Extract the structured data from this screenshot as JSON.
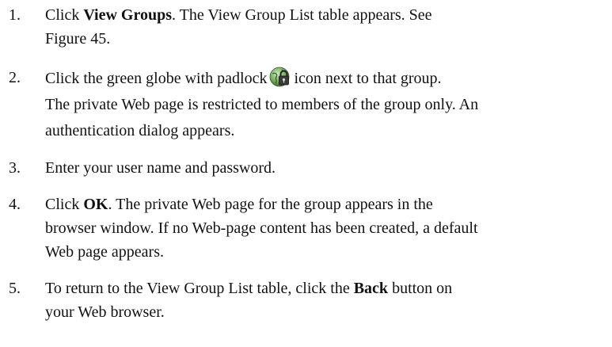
{
  "steps": [
    {
      "number": "1.",
      "line1": {
        "pre": "Click ",
        "bold": "View Groups",
        "post": ". The View Group List table appears. See"
      },
      "line2": "Figure 45."
    },
    {
      "number": "2.",
      "line1": {
        "pre": "Click the green globe with padlock",
        "icon": "globe-padlock-icon",
        "post": "icon next to that group."
      },
      "line2": "The private Web page is restricted to members of the group only. An",
      "line3": "authentication dialog appears."
    },
    {
      "number": "3.",
      "line1": "Enter your user name and password."
    },
    {
      "number": "4.",
      "line1": {
        "pre": "Click ",
        "bold": "OK",
        "post": ". The private Web page for the group appears in the"
      },
      "line2": "browser window. If no Web-page content has been created, a default",
      "line3": "Web page appears."
    },
    {
      "number": "5.",
      "line1": {
        "pre": "To return to the View Group List table, click the ",
        "bold": "Back",
        "post": " button on"
      },
      "line2": "your Web browser."
    }
  ],
  "colors": {
    "text": "#111111",
    "icon_globe": "#4f8f3a",
    "icon_lock": "#2a2a2a"
  }
}
